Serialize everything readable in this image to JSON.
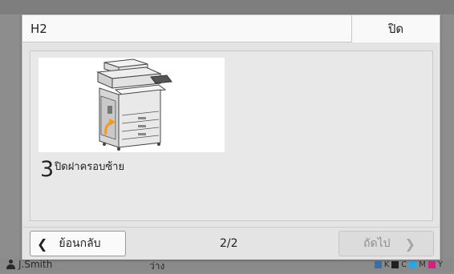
{
  "dialog": {
    "title": "H2",
    "close_label": "ปิด"
  },
  "step": {
    "number": "3",
    "text": "ปิดฝาครอบซ้าย"
  },
  "footer": {
    "back_label": "ย้อนกลับ",
    "page_indicator": "2/2",
    "next_label": "ถัดไป"
  },
  "background": {
    "user_name": "J.Smith",
    "middle_text": "ว่าง",
    "toner_labels": [
      "K",
      "C",
      "M",
      "Y"
    ],
    "toner_colors": [
      "#202020",
      "#29a7e1",
      "#d6207e",
      "#f5e600"
    ]
  },
  "colors": {
    "orange_arrow": "#f29a1e"
  }
}
